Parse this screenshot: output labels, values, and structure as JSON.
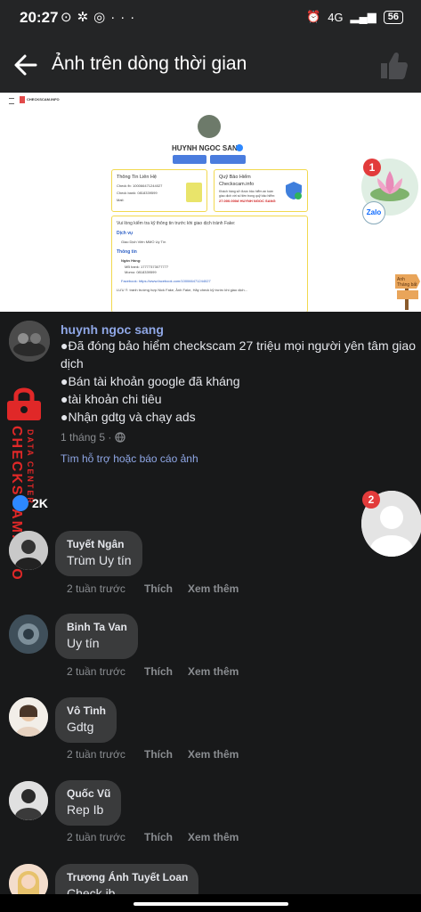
{
  "status_bar": {
    "time": "20:27",
    "network": "4G",
    "battery": "56"
  },
  "header": {
    "title": "Ảnh trên dòng thời gian"
  },
  "photo": {
    "logo_text": "CHECKSCAM.INFO",
    "profile_name": "HUYNH NGOC SANG",
    "button_check_bank": "Check bank",
    "button_check_phone": "Check phone",
    "contact_title": "Thông Tin Liên Hệ",
    "contact_facebook": "Check fb: 100066471244027",
    "contact_bank": "Check bank: 0818339599",
    "contact_mail": "Mail:",
    "insurance_title": "Quỹ Bảo Hiểm Checkscam.info",
    "insurance_text": "Khách hàng sở được bảo hiểm an toàn giao dịch với số tiền trong quỹ bảo hiểm:",
    "insurance_amount": "27.000.000đ",
    "insurance_owner": "HUYNH NGOC SANG",
    "warning": "Vui lòng kiểm tra kỹ thông tin trước khi giao dịch tránh Fake:",
    "services_title": "Dịch vụ",
    "service_item": "Giao Dịch Viên MMO Uy Tín",
    "info_title": "Thông tin",
    "bank_label": "Ngân Hàng:",
    "bank_line1": "MB bank: 17777373077777",
    "bank_line2": "Momo: 0818339599",
    "facebook_line": "Facebook: https://www.facebook.com/100066471244027",
    "note": "LƯU Ý: tránh trường hợp Nick Fake, Ảnh Fake, Hãy check kỹ trước khi giao dịch...",
    "sign_text": "Anh Tháng bất"
  },
  "chat_heads": [
    {
      "badge": "1",
      "app": "Zalo"
    },
    {
      "badge": "2"
    }
  ],
  "post": {
    "author": "huynh ngoc sang",
    "lines": [
      "●Đã đóng bảo hiểm checkscam 27 triệu mọi người yên tâm giao dịch",
      "●Bán tài khoản google đã kháng",
      "●tài khoản chi tiêu",
      "●Nhận gdtg và chạy ads"
    ],
    "date": "1 tháng 5 ·",
    "report_link": "Tìm hỗ trợ hoặc báo cáo ảnh",
    "reaction_count": "2K"
  },
  "watermark": {
    "main": "CHECKSCAM.INFO",
    "sub": "DATA CENTER"
  },
  "comments": [
    {
      "name": "Tuyết Ngân",
      "text": "Trùm Uy tín",
      "time": "2 tuần trước",
      "like": "Thích",
      "reply": "Xem thêm"
    },
    {
      "name": "Binh Ta Van",
      "text": "Uy tín",
      "time": "2 tuần trước",
      "like": "Thích",
      "reply": "Xem thêm"
    },
    {
      "name": "Vô Tình",
      "text": "Gdtg",
      "time": "2 tuần trước",
      "like": "Thích",
      "reply": "Xem thêm"
    },
    {
      "name": "Quốc Vũ",
      "text": "Rep Ib",
      "time": "2 tuần trước",
      "like": "Thích",
      "reply": "Xem thêm"
    },
    {
      "name": "Trương Ánh Tuyết Loan",
      "text": "Check ib",
      "time": "",
      "like": "",
      "reply": ""
    }
  ]
}
